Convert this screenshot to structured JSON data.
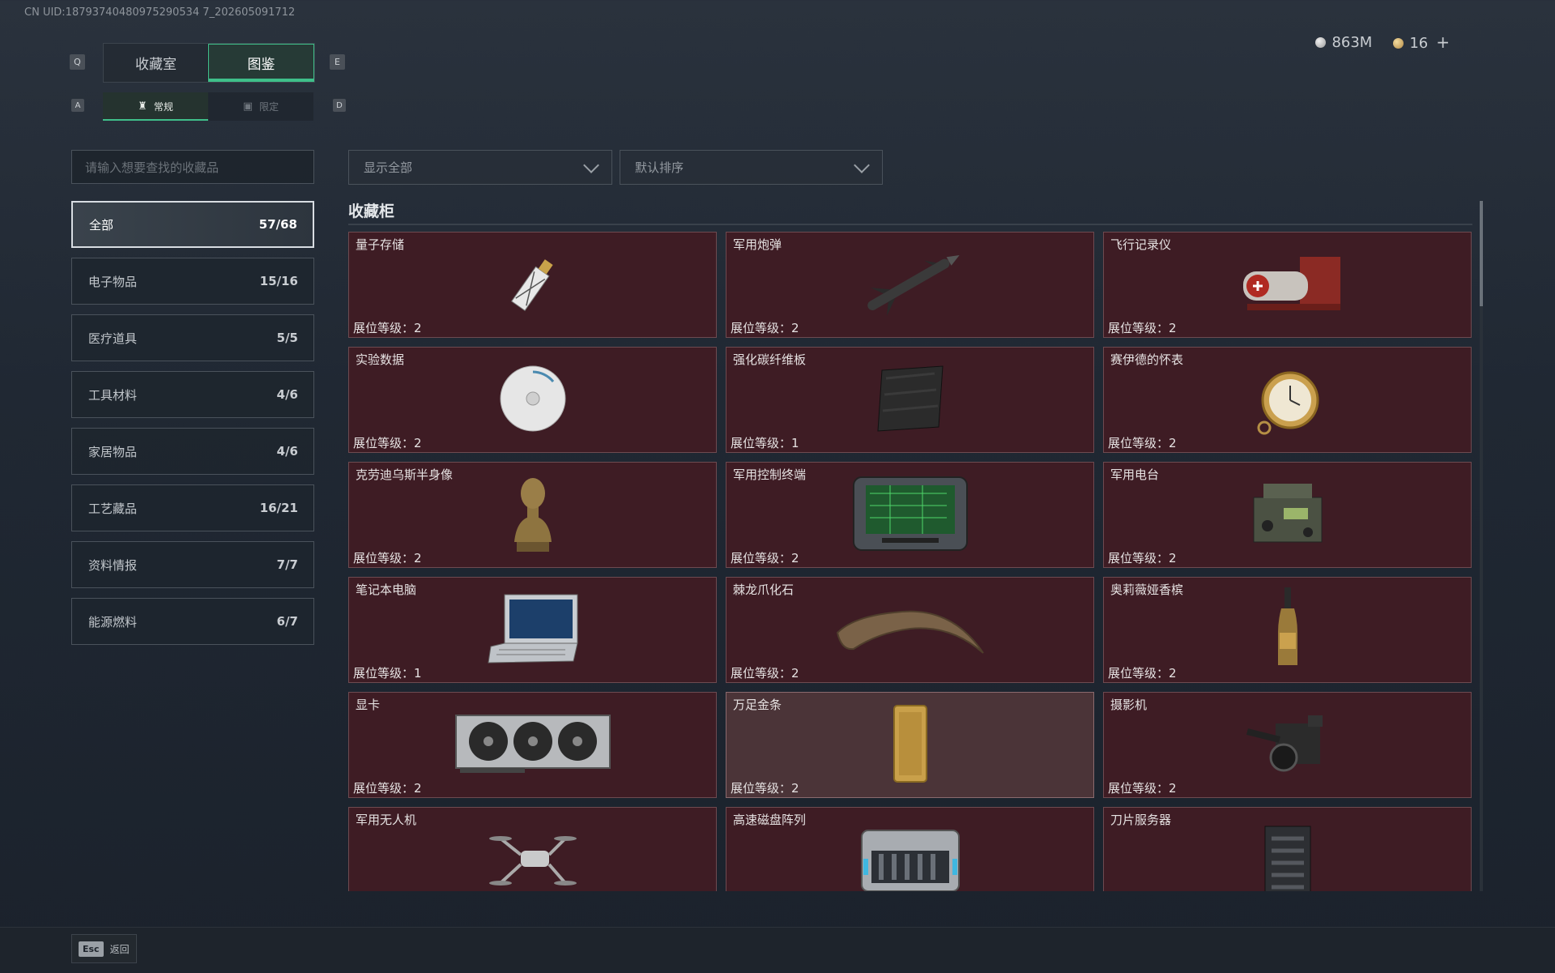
{
  "uid_text": "CN UID:18793740480975290534 7_202605091712",
  "tabs": {
    "left_key": "Q",
    "right_key": "E",
    "items": [
      {
        "label": "收藏室"
      },
      {
        "label": "图鉴"
      }
    ]
  },
  "subtabs": {
    "left_key": "A",
    "right_key": "D",
    "items": [
      {
        "label": "常规"
      },
      {
        "label": "限定"
      }
    ]
  },
  "currency": {
    "silver": "863M",
    "gold": "16",
    "plus": "+"
  },
  "search": {
    "placeholder": "请输入想要查找的收藏品"
  },
  "filter_dropdown": {
    "value": "显示全部"
  },
  "sort_dropdown": {
    "value": "默认排序"
  },
  "categories": [
    {
      "label": "全部",
      "count": "57/68"
    },
    {
      "label": "电子物品",
      "count": "15/16"
    },
    {
      "label": "医疗道具",
      "count": "5/5"
    },
    {
      "label": "工具材料",
      "count": "4/6"
    },
    {
      "label": "家居物品",
      "count": "4/6"
    },
    {
      "label": "工艺藏品",
      "count": "16/21"
    },
    {
      "label": "资料情报",
      "count": "7/7"
    },
    {
      "label": "能源燃料",
      "count": "6/7"
    }
  ],
  "section_title": "收藏柜",
  "items": [
    {
      "name": "量子存储",
      "level": "展位等级：2",
      "icon": "usb-stick"
    },
    {
      "name": "军用炮弹",
      "level": "展位等级：2",
      "icon": "missile"
    },
    {
      "name": "飞行记录仪",
      "level": "展位等级：2",
      "icon": "flight-recorder"
    },
    {
      "name": "实验数据",
      "level": "展位等级：2",
      "icon": "disc"
    },
    {
      "name": "强化碳纤维板",
      "level": "展位等级：1",
      "icon": "carbon-plate"
    },
    {
      "name": "赛伊德的怀表",
      "level": "展位等级：2",
      "icon": "pocket-watch"
    },
    {
      "name": "克劳迪乌斯半身像",
      "level": "展位等级：2",
      "icon": "bust"
    },
    {
      "name": "军用控制终端",
      "level": "展位等级：2",
      "icon": "control-terminal"
    },
    {
      "name": "军用电台",
      "level": "展位等级：2",
      "icon": "radio"
    },
    {
      "name": "笔记本电脑",
      "level": "展位等级：1",
      "icon": "laptop"
    },
    {
      "name": "棘龙爪化石",
      "level": "展位等级：2",
      "icon": "claw-fossil"
    },
    {
      "name": "奥莉薇娅香槟",
      "level": "展位等级：2",
      "icon": "champagne"
    },
    {
      "name": "显卡",
      "level": "展位等级：2",
      "icon": "graphics-card"
    },
    {
      "name": "万足金条",
      "level": "展位等级：2",
      "icon": "gold-bar"
    },
    {
      "name": "摄影机",
      "level": "展位等级：2",
      "icon": "camera"
    },
    {
      "name": "军用无人机",
      "level": "",
      "icon": "drone"
    },
    {
      "name": "高速磁盘阵列",
      "level": "",
      "icon": "disk-array"
    },
    {
      "name": "刀片服务器",
      "level": "",
      "icon": "blade-server"
    }
  ],
  "footer": {
    "esc_key": "Esc",
    "back_label": "返回"
  },
  "colors": {
    "accent_green": "#3fbf8a",
    "card_bg": "#3e1c24",
    "card_highlight_bg": "#4b3438"
  }
}
